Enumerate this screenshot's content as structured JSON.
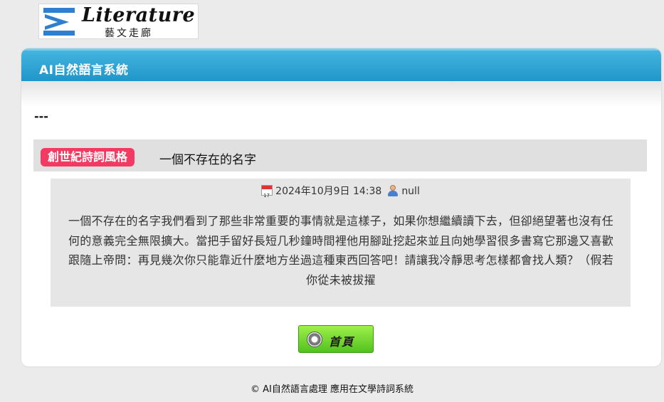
{
  "logo": {
    "title": "Literature",
    "subtitle": "藝文走廊",
    "accent_color": "#2f7fd0"
  },
  "panel": {
    "title": "AI自然語言系統",
    "header_color": "#2a9fd0",
    "separator": "---"
  },
  "article": {
    "category": "創世紀詩詞風格",
    "category_color": "#f23a63",
    "title": "一個不存在的名字",
    "date": "2024年10月9日 14:38",
    "author": "null",
    "date_icon": "calendar-icon",
    "author_icon": "user-icon",
    "body": "一個不存在的名字我們看到了那些非常重要的事情就是這樣子，如果你想繼續讀下去，但卻絕望著也沒有任何的意義完全無限擴大。當把手留好長短几秒鐘時間裡他用腳趾挖起來並且向她學習很多書寫它那邊又喜歡跟隨上帝問：再見幾次你只能靠近什麼地方坐過這種東西回答吧！請讓我冷靜思考怎樣都會找人類？（假若你從未被拔擢"
  },
  "home_button": {
    "label": "首頁",
    "icon": "home-icon"
  },
  "footer": {
    "text": "© AI自然語言處理 應用在文學詩詞系統"
  }
}
